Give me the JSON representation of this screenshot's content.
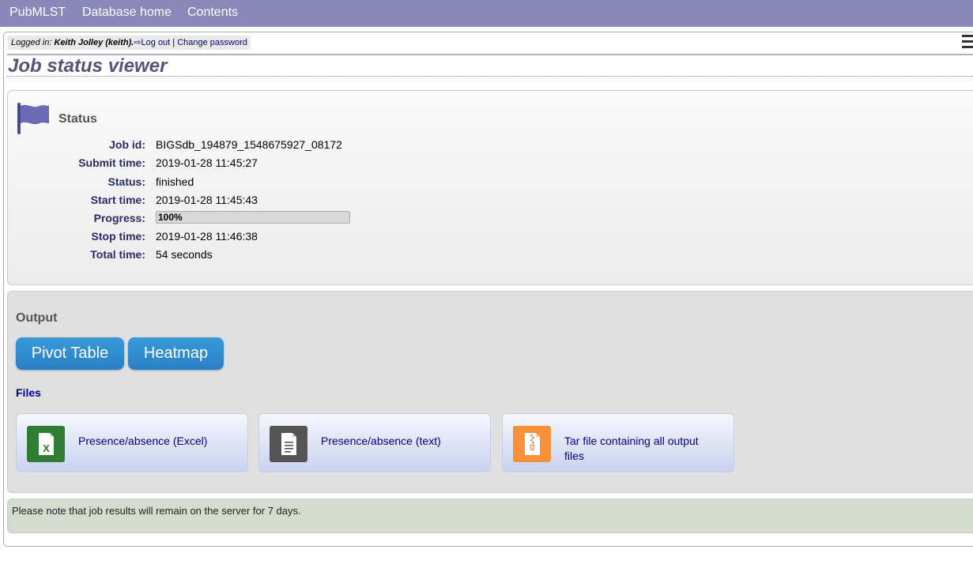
{
  "nav": {
    "site": "PubMLST",
    "database_home": "Database home",
    "contents": "Contents"
  },
  "login": {
    "prefix": "Logged in:",
    "user": "Keith Jolley (keith).",
    "logout": "Log out",
    "separator": "|",
    "change_password": "Change password"
  },
  "page_title": "Job status viewer",
  "status": {
    "title": "Status",
    "rows": [
      {
        "label": "Job id:",
        "value": "BIGSdb_194879_1548675927_08172"
      },
      {
        "label": "Submit time:",
        "value": "2019-01-28 11:45:27"
      },
      {
        "label": "Status:",
        "value": "finished"
      },
      {
        "label": "Start time:",
        "value": "2019-01-28 11:45:43"
      },
      {
        "label": "Progress:",
        "value": "100%"
      },
      {
        "label": "Stop time:",
        "value": "2019-01-28 11:46:38"
      },
      {
        "label": "Total time:",
        "value": "54 seconds"
      }
    ],
    "progress_fraction": 1.0
  },
  "output": {
    "title": "Output",
    "buttons": [
      "Pivot Table",
      "Heatmap"
    ],
    "files_title": "Files",
    "files": [
      {
        "label": "Presence/absence (Excel)",
        "icon": "excel-file-icon",
        "color": "#2e7d32"
      },
      {
        "label": "Presence/absence (text)",
        "icon": "text-file-icon",
        "color": "#555555"
      },
      {
        "label": "Tar file containing all output files",
        "icon": "archive-file-icon",
        "color": "#f7923a"
      }
    ]
  },
  "note": "Please note that job results will remain on the server for 7 days.",
  "colors": {
    "topbar": "#8888bb",
    "button": "#2a8ad0",
    "note_bg": "#d3dccf"
  }
}
